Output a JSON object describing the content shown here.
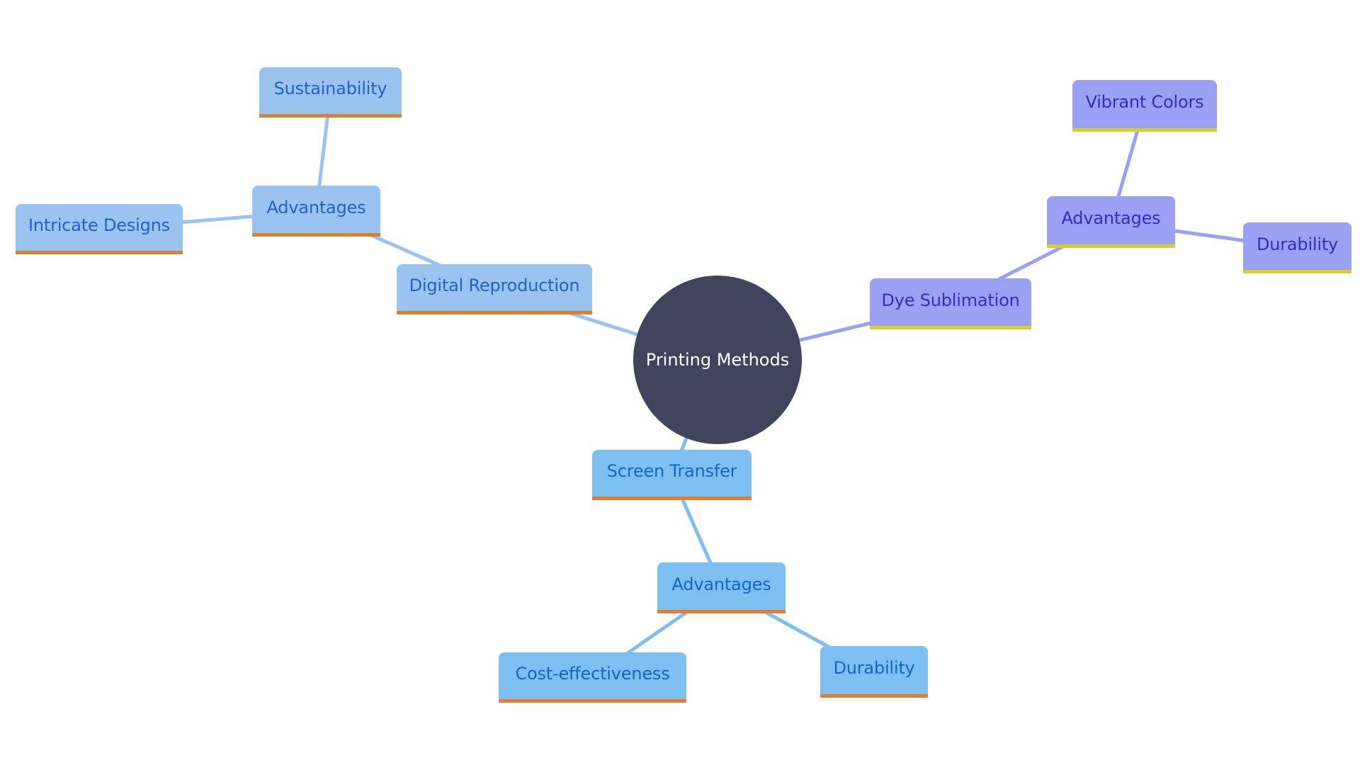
{
  "diagram": {
    "type": "mindmap",
    "root": {
      "id": "root",
      "label": "Printing Methods",
      "color": "#41455c",
      "text_color": "#ffffff"
    },
    "branch_colors": {
      "digital": {
        "fill": "#9ac3f0",
        "text": "#1f63c6",
        "underline": "#d4832e",
        "edge": "#9ac3f0"
      },
      "screen": {
        "fill": "#7ebff1",
        "text": "#1068c2",
        "underline": "#e47d30",
        "edge": "#7ebff1"
      },
      "dye": {
        "fill": "#9aa0f2",
        "text": "#2d31c0",
        "underline": "#d8cf2a",
        "edge": "#9aa0f2"
      }
    },
    "nodes": [
      {
        "id": "digital",
        "label": "Digital Reproduction",
        "parent": "root",
        "branch": "digital"
      },
      {
        "id": "digital_adv",
        "label": "Advantages",
        "parent": "digital",
        "branch": "digital"
      },
      {
        "id": "sustainability",
        "label": "Sustainability",
        "parent": "digital_adv",
        "branch": "digital"
      },
      {
        "id": "intricate",
        "label": "Intricate Designs",
        "parent": "digital_adv",
        "branch": "digital"
      },
      {
        "id": "dye",
        "label": "Dye Sublimation",
        "parent": "root",
        "branch": "dye"
      },
      {
        "id": "dye_adv",
        "label": "Advantages",
        "parent": "dye",
        "branch": "dye"
      },
      {
        "id": "vibrant",
        "label": "Vibrant Colors",
        "parent": "dye_adv",
        "branch": "dye"
      },
      {
        "id": "dye_durability",
        "label": "Durability",
        "parent": "dye_adv",
        "branch": "dye"
      },
      {
        "id": "screen",
        "label": "Screen Transfer",
        "parent": "root",
        "branch": "screen"
      },
      {
        "id": "screen_adv",
        "label": "Advantages",
        "parent": "screen",
        "branch": "screen"
      },
      {
        "id": "cost",
        "label": "Cost-effectiveness",
        "parent": "screen_adv",
        "branch": "screen"
      },
      {
        "id": "screen_durability",
        "label": "Durability",
        "parent": "screen_adv",
        "branch": "screen"
      }
    ]
  }
}
